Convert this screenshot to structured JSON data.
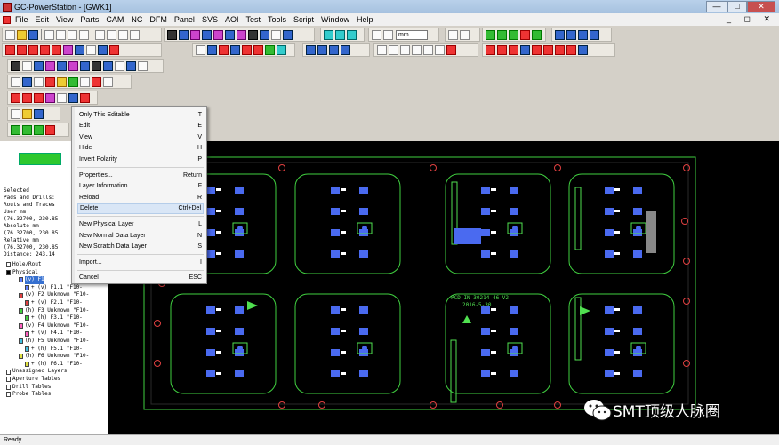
{
  "window": {
    "title": "GC-PowerStation - [GWK1]",
    "minimize": "—",
    "maximize": "□",
    "close": "✕"
  },
  "menu": [
    "File",
    "Edit",
    "View",
    "Parts",
    "CAM",
    "NC",
    "DFM",
    "Panel",
    "SVS",
    "AOI",
    "Test",
    "Tools",
    "Script",
    "Window",
    "Help"
  ],
  "mdi_controls": "_ ◻ ✕",
  "toolbar": {
    "units_combo": "mm"
  },
  "left_panel": {
    "info_lines": [
      "Selected",
      "Pads and Drills:",
      "Routs and Traces",
      "User mm",
      "(76.32700, 230.85",
      "Absolute mm",
      "(76.32700, 230.85",
      "Relative mm",
      "(76.32700, 230.85",
      "Distance: 243.14"
    ],
    "tree": [
      {
        "text": "Hole/Rout",
        "indent": 1,
        "color": "#ffffff",
        "selected": false
      },
      {
        "text": "Physical",
        "indent": 1,
        "color": "#000000",
        "selected": false
      },
      {
        "text": "(v) F1 ",
        "indent": 3,
        "color": "#6080ff",
        "selected": true
      },
      {
        "text": "+ (v) F1.1 \"F10-",
        "indent": 4,
        "color": "#6080ff",
        "selected": false
      },
      {
        "text": "(v) F2 Unknown \"F10-",
        "indent": 3,
        "color": "#e04040",
        "selected": false
      },
      {
        "text": "+ (v) F2.1 \"F10-",
        "indent": 4,
        "color": "#e04040",
        "selected": false
      },
      {
        "text": "(h) F3 Unknown \"F10-",
        "indent": 3,
        "color": "#40d040",
        "selected": false
      },
      {
        "text": "+ (h) F3.1 \"F10-",
        "indent": 4,
        "color": "#40d040",
        "selected": false
      },
      {
        "text": "(v) F4 Unknown \"F10-",
        "indent": 3,
        "color": "#ff60c0",
        "selected": false
      },
      {
        "text": "+ (v) F4.1 \"F10-",
        "indent": 4,
        "color": "#ff60c0",
        "selected": false
      },
      {
        "text": "(h) F5 Unknown \"F10-",
        "indent": 3,
        "color": "#40c0e0",
        "selected": false
      },
      {
        "text": "+ (h) F5.1 \"F10-",
        "indent": 4,
        "color": "#40c0e0",
        "selected": false
      },
      {
        "text": "(h) F6 Unknown \"F10-",
        "indent": 3,
        "color": "#e0e040",
        "selected": false
      },
      {
        "text": "+ (h) F6.1 \"F10-",
        "indent": 4,
        "color": "#e0e040",
        "selected": false
      },
      {
        "text": "Unassigned Layers",
        "indent": 1,
        "color": "#ffffff",
        "selected": false
      },
      {
        "text": "Aperture Tables",
        "indent": 1,
        "color": "#ffffff",
        "selected": false
      },
      {
        "text": "Drill Tables",
        "indent": 1,
        "color": "#ffffff",
        "selected": false
      },
      {
        "text": "Probe Tables",
        "indent": 1,
        "color": "#ffffff",
        "selected": false
      }
    ]
  },
  "context_menu": [
    {
      "label": "Only This Editable",
      "shortcut": "T"
    },
    {
      "label": "Edit",
      "shortcut": "E"
    },
    {
      "label": "View",
      "shortcut": "V"
    },
    {
      "label": "Hide",
      "shortcut": "H"
    },
    {
      "label": "Invert Polarity",
      "shortcut": "P"
    },
    {
      "sep": true
    },
    {
      "label": "Properties...",
      "shortcut": "Return"
    },
    {
      "label": "Layer Information",
      "shortcut": "F"
    },
    {
      "label": "Reload",
      "shortcut": "R"
    },
    {
      "label": "Delete",
      "shortcut": "Ctrl+Del",
      "highlight": true
    },
    {
      "sep": true
    },
    {
      "label": "New Physical Layer",
      "shortcut": "L"
    },
    {
      "label": "New Normal Data Layer",
      "shortcut": "N"
    },
    {
      "label": "New Scratch Data Layer",
      "shortcut": "S"
    },
    {
      "sep": true
    },
    {
      "label": "Import...",
      "shortcut": "I"
    },
    {
      "sep": true
    },
    {
      "label": "Cancel",
      "shortcut": "ESC"
    }
  ],
  "board_text": {
    "label1": "PCD-IN-30214-46-V2",
    "label2": "2016-5-30"
  },
  "status": "Ready",
  "watermark": "SMT顶级人脉圈",
  "colors": {
    "canvas": "#000000",
    "outline": "#40d040",
    "holes": "#e04040",
    "pads_blue": "#4a6af0",
    "pads_green": "#50e050",
    "pads_white": "#ffffff"
  }
}
